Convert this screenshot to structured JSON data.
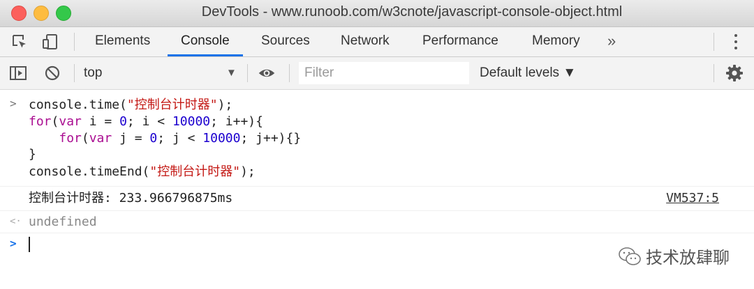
{
  "window": {
    "title": "DevTools - www.runoob.com/w3cnote/javascript-console-object.html"
  },
  "tabs": [
    {
      "label": "Elements",
      "active": false
    },
    {
      "label": "Console",
      "active": true
    },
    {
      "label": "Sources",
      "active": false
    },
    {
      "label": "Network",
      "active": false
    },
    {
      "label": "Performance",
      "active": false
    },
    {
      "label": "Memory",
      "active": false
    }
  ],
  "tabs_more": "»",
  "toolbar": {
    "context": "top",
    "filter_placeholder": "Filter",
    "levels": "Default levels ▼"
  },
  "console": {
    "code": {
      "l1": {
        "a": "console.time(",
        "b": "\"控制台计时器\"",
        "c": ");"
      },
      "l2": {
        "kw1": "for",
        "a": "(",
        "kw2": "var",
        "b": " i = ",
        "n1": "0",
        "c": "; i < ",
        "n2": "10000",
        "d": "; i++){"
      },
      "l3": {
        "indent": "    ",
        "kw1": "for",
        "a": "(",
        "kw2": "var",
        "b": " j = ",
        "n1": "0",
        "c": "; j < ",
        "n2": "10000",
        "d": "; j++){}"
      },
      "l4": "}",
      "l5": {
        "a": "console.timeEnd(",
        "b": "\"控制台计时器\"",
        "c": ");"
      }
    },
    "output_text": "控制台计时器: 233.966796875ms",
    "output_source": "VM537:5",
    "return_value": "undefined"
  },
  "watermark": "技术放肆聊",
  "colors": {
    "keyword": "#aa0d91",
    "string": "#c41a16",
    "number": "#1c00cf",
    "active_tab_underline": "#1a73e8"
  }
}
